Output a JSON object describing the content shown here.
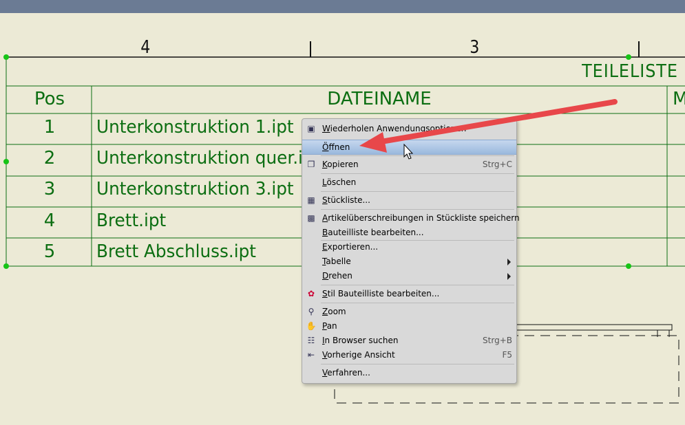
{
  "drawing": {
    "zone_labels": [
      "4",
      "3"
    ],
    "table_title": "TEILELISTE",
    "headers": {
      "pos": "Pos",
      "name": "DATEINAME",
      "next": "M"
    },
    "rows": [
      {
        "pos": "1",
        "name": "Unterkonstruktion 1.ipt"
      },
      {
        "pos": "2",
        "name": "Unterkonstruktion quer.ipt"
      },
      {
        "pos": "3",
        "name": "Unterkonstruktion 3.ipt"
      },
      {
        "pos": "4",
        "name": "Brett.ipt"
      },
      {
        "pos": "5",
        "name": "Brett Abschluss.ipt"
      }
    ],
    "colors": {
      "line": "#0c6e12",
      "grip": "#17c417",
      "background": "#ecead6"
    }
  },
  "context_menu": {
    "items": [
      {
        "label": "Wiederholen Anwendungsoptionen",
        "icon": "options-window-icon"
      },
      {
        "label": "Öffnen",
        "highlighted": true
      },
      {
        "label": "Kopieren",
        "shortcut": "Strg+C",
        "icon": "copy-icon"
      },
      {
        "label": "Löschen"
      },
      {
        "label": "Stückliste...",
        "icon": "bom-icon"
      },
      {
        "label": "Artikelüberschreibungen in Stückliste speichern",
        "icon": "save-overrides-icon"
      },
      {
        "label": "Bauteilliste bearbeiten..."
      },
      {
        "label": "Exportieren..."
      },
      {
        "label": "Tabelle",
        "submenu": true
      },
      {
        "label": "Drehen",
        "submenu": true
      },
      {
        "label": "Stil Bauteilliste bearbeiten...",
        "icon": "style-icon"
      },
      {
        "label": "Zoom",
        "icon": "zoom-icon"
      },
      {
        "label": "Pan",
        "icon": "pan-hand-icon"
      },
      {
        "label": "In Browser suchen",
        "shortcut": "Strg+B",
        "icon": "find-in-browser-icon"
      },
      {
        "label": "Vorherige Ansicht",
        "shortcut": "F5",
        "icon": "previous-view-icon"
      },
      {
        "label": "Verfahren..."
      }
    ],
    "highlight_color": "#9bb9dd"
  },
  "annotation": {
    "arrow_color": "#e8474a"
  }
}
